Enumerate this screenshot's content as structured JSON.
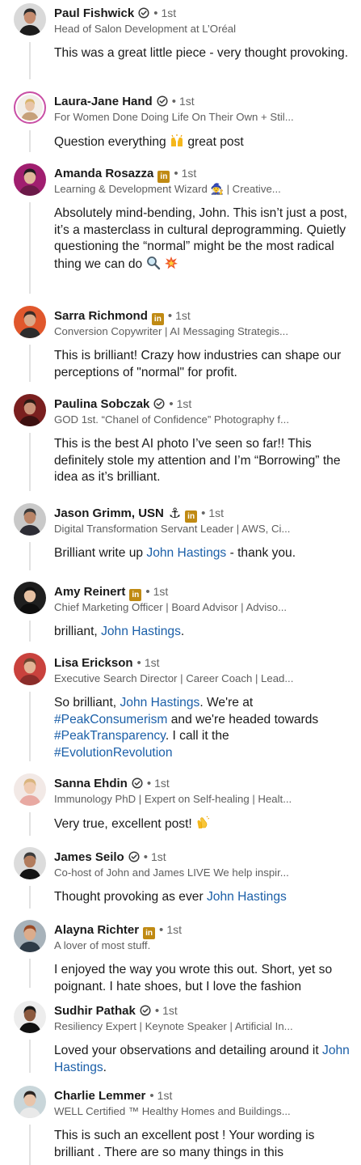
{
  "comments": [
    {
      "name": "Paul Fishwick",
      "badge": "verified",
      "degree": "1st",
      "headline": "Head of Salon Development at L’Oréal",
      "parts": [
        {
          "text": "This was a great little piece - very thought provoking."
        }
      ]
    },
    {
      "name": "Laura-Jane Hand",
      "badge": "verified",
      "degree": "1st",
      "headline": "For Women Done Doing Life On Their Own + Stil...",
      "parts": [
        {
          "text": "Question everything "
        },
        {
          "emoji": "raised-hands-emoji"
        },
        {
          "text": " great post"
        }
      ]
    },
    {
      "name": "Amanda Rosazza",
      "badge": "linkedin-premium",
      "degree": "1st",
      "headline": "Learning & Development Wizard 🧙‍♀️ | Creative...",
      "parts": [
        {
          "text": "Absolutely mind-bending, John. This isn’t just a post, it’s a masterclass in cultural deprogramming. Quietly questioning the “normal” might be the most radical thing we can do "
        },
        {
          "emoji": "magnifier-emoji"
        },
        {
          "text": " "
        },
        {
          "emoji": "collision-emoji"
        }
      ]
    },
    {
      "name": "Sarra Richmond",
      "badge": "linkedin-premium",
      "degree": "1st",
      "headline": "Conversion Copywriter | AI Messaging Strategis...",
      "parts": [
        {
          "text": "This is brilliant! Crazy how industries can shape our perceptions of \"normal\" for profit."
        }
      ]
    },
    {
      "name": "Paulina Sobczak",
      "badge": "verified",
      "degree": "1st",
      "headline": "GOD 1st. “Chanel of Confidence” Photography f...",
      "parts": [
        {
          "text": "This is the best AI photo I’ve seen so far!! This definitely stole my attention and I’m  “Borrowing” the idea as it’s brilliant."
        }
      ]
    },
    {
      "name": "Jason Grimm, USN",
      "badge": "anchor+linkedin-premium",
      "degree": "1st",
      "headline": "Digital Transformation Servant Leader | AWS, Ci...",
      "parts": [
        {
          "text": "Brilliant write up "
        },
        {
          "mention": "John Hastings"
        },
        {
          "text": " - thank you."
        }
      ]
    },
    {
      "name": "Amy Reinert",
      "badge": "linkedin-premium",
      "degree": "1st",
      "headline": "Chief Marketing Officer | Board Advisor | Adviso...",
      "parts": [
        {
          "text": "brilliant, "
        },
        {
          "mention": "John Hastings"
        },
        {
          "text": "."
        }
      ]
    },
    {
      "name": "Lisa Erickson",
      "badge": "none",
      "degree": "1st",
      "headline": "Executive Search Director | Career Coach | Lead...",
      "parts": [
        {
          "text": "So brilliant, "
        },
        {
          "mention": "John Hastings"
        },
        {
          "text": ". We're at "
        },
        {
          "mention": "#PeakConsumerism"
        },
        {
          "text": " and we're headed towards "
        },
        {
          "mention": "#PeakTransparency"
        },
        {
          "text": ". I call it the "
        },
        {
          "mention": "#EvolutionRevolution"
        }
      ]
    },
    {
      "name": "Sanna Ehdin",
      "badge": "verified",
      "degree": "1st",
      "headline": "Immunology PhD | Expert on Self-healing | Healt...",
      "parts": [
        {
          "text": "Very true, excellent post! "
        },
        {
          "emoji": "clapping-hands-emoji"
        }
      ]
    },
    {
      "name": "James Seilo",
      "badge": "verified",
      "degree": "1st",
      "headline": "Co-host of John and James LIVE We help inspir...",
      "parts": [
        {
          "text": "Thought provoking as ever "
        },
        {
          "mention": "John Hastings"
        }
      ]
    },
    {
      "name": "Alayna Richter",
      "badge": "linkedin-premium",
      "degree": "1st",
      "headline": "A lover of most stuff.",
      "parts": [
        {
          "text": "I enjoyed the way you wrote this out. Short, yet so poignant. I hate shoes, but I love the fashion"
        }
      ]
    },
    {
      "name": "Sudhir Pathak",
      "badge": "verified",
      "degree": "1st",
      "headline": "Resiliency Expert | Keynote Speaker | Artificial In...",
      "parts": [
        {
          "text": "Loved your observations and detailing around it "
        },
        {
          "mention": "John Hastings"
        },
        {
          "text": "."
        }
      ]
    },
    {
      "name": "Charlie Lemmer",
      "badge": "none",
      "degree": "1st",
      "headline": "WELL Certified ™ Healthy Homes and Buildings...",
      "parts": [
        {
          "text": "This is such an excellent post ! Your wording is brilliant . There are so many things in this"
        }
      ]
    }
  ],
  "dot_separator": "•",
  "colors": {
    "mention": "#1b5fa8",
    "premium_badge": "#c08a13",
    "thread_line": "#e2e2e2",
    "avatar_ring": "#c94fa5"
  },
  "icons": {
    "verified": "shield-check-icon",
    "linkedin-premium": "linkedin-premium-icon",
    "anchor": "anchor-icon"
  }
}
